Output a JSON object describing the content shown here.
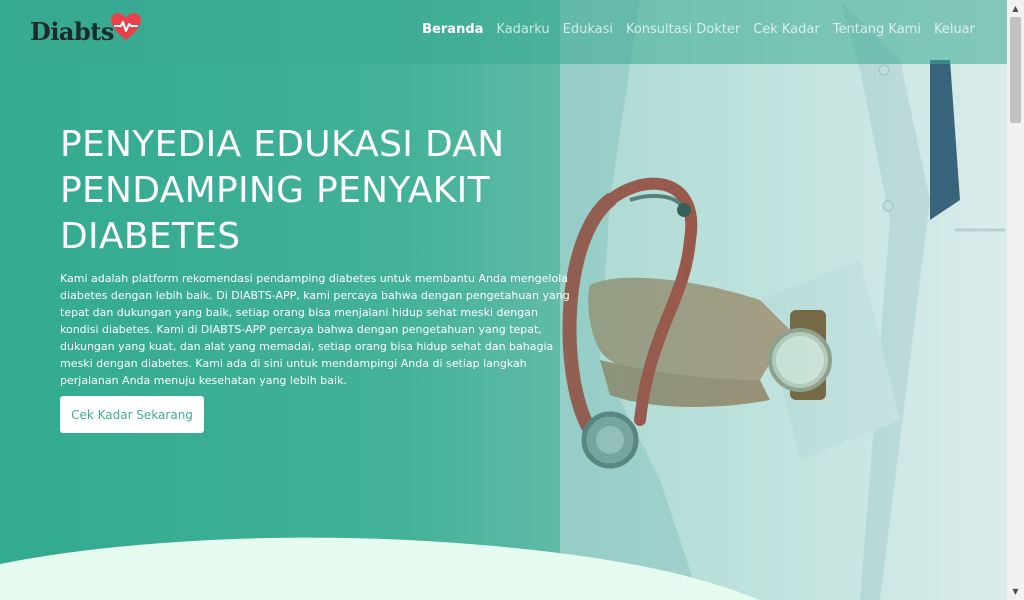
{
  "brand": {
    "name": "Diabts",
    "logo_icon": "heart-pulse-icon",
    "heart_color": "#e8414b"
  },
  "nav": {
    "items": [
      {
        "label": "Beranda",
        "active": true
      },
      {
        "label": "Kadarku"
      },
      {
        "label": "Edukasi"
      },
      {
        "label": "Konsultasi Dokter"
      },
      {
        "label": "Cek Kadar"
      },
      {
        "label": "Tentang Kami"
      },
      {
        "label": "Keluar"
      }
    ]
  },
  "hero": {
    "title": "PENYEDIA EDUKASI DAN PENDAMPING PENYAKIT DIABETES",
    "description": "Kami adalah platform rekomendasi pendamping diabetes untuk membantu Anda mengelola diabetes dengan lebih baik. Di DIABTS-APP, kami percaya bahwa dengan pengetahuan yang tepat dan dukungan yang baik, setiap orang bisa menjalani hidup sehat meski dengan kondisi diabetes. Kami di DIABTS-APP percaya bahwa dengan pengetahuan yang tepat, dukungan yang kuat, dan alat yang memadai, setiap orang bisa hidup sehat dan bahagia meski dengan diabetes. Kami ada di sini untuk mendampingi Anda di setiap langkah perjalanan Anda menuju kesehatan yang lebih baik.",
    "cta_label": "Cek Kadar Sekarang",
    "image": "doctor-with-stethoscope-photo"
  },
  "colors": {
    "primary": "#3fae95",
    "wave": "#e6fbef",
    "stethoscope": "#c53a34"
  }
}
